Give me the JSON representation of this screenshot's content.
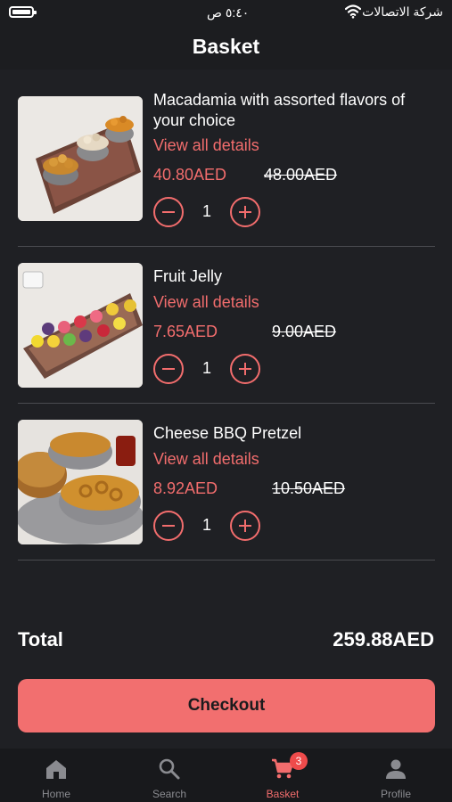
{
  "status_bar": {
    "time": "٥:٤٠ ص",
    "carrier": "شركة الاتصالات"
  },
  "header": {
    "title": "Basket"
  },
  "items": [
    {
      "name": "Macadamia with assorted flavors of your choice",
      "details_link": "View all details",
      "price": "40.80AED",
      "old_price": "48.00AED",
      "quantity": "1"
    },
    {
      "name": "Fruit Jelly",
      "details_link": "View all details",
      "price": "7.65AED",
      "old_price": "9.00AED",
      "quantity": "1"
    },
    {
      "name": "Cheese BBQ Pretzel",
      "details_link": "View all details",
      "price": "8.92AED",
      "old_price": "10.50AED",
      "quantity": "1"
    }
  ],
  "summary": {
    "total_label": "Total",
    "total_value": "259.88AED"
  },
  "checkout": {
    "label": "Checkout"
  },
  "tabbar": {
    "tabs": [
      {
        "label": "Home",
        "icon": "home-icon"
      },
      {
        "label": "Search",
        "icon": "search-icon"
      },
      {
        "label": "Basket",
        "icon": "cart-icon",
        "badge": "3",
        "active": true
      },
      {
        "label": "Profile",
        "icon": "person-icon"
      }
    ]
  },
  "colors": {
    "accent": "#f26d6d",
    "background": "#1f2024",
    "tabbar": "#18191c",
    "badge": "#ef4b4b"
  }
}
